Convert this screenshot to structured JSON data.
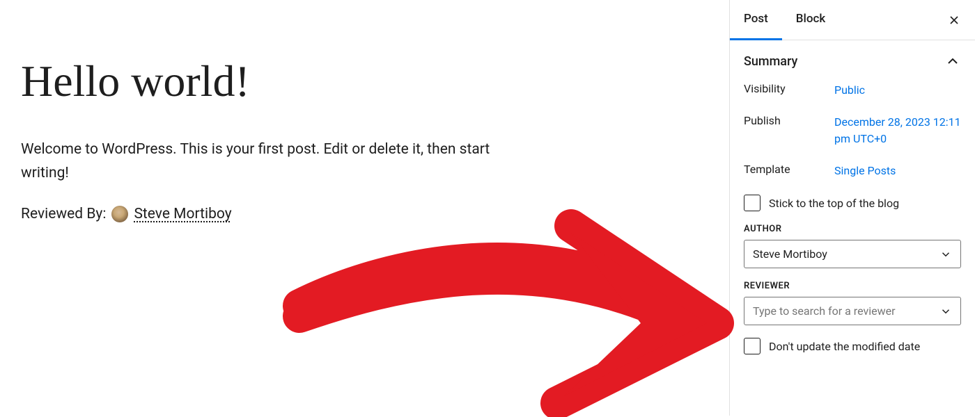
{
  "editor": {
    "title": "Hello world!",
    "body": "Welcome to WordPress. This is your first post. Edit or delete it, then start writing!",
    "reviewed_label": "Reviewed By:",
    "reviewer_name": "Steve Mortiboy"
  },
  "sidebar": {
    "tabs": {
      "post": "Post",
      "block": "Block"
    },
    "summary": {
      "header": "Summary",
      "visibility_label": "Visibility",
      "visibility_value": "Public",
      "publish_label": "Publish",
      "publish_value": "December 28, 2023 12:11 pm UTC+0",
      "template_label": "Template",
      "template_value": "Single Posts"
    },
    "sticky_label": "Stick to the top of the blog",
    "author": {
      "label": "AUTHOR",
      "value": "Steve Mortiboy"
    },
    "reviewer": {
      "label": "REVIEWER",
      "placeholder": "Type to search for a reviewer"
    },
    "dont_update_label": "Don't update the modified date"
  }
}
